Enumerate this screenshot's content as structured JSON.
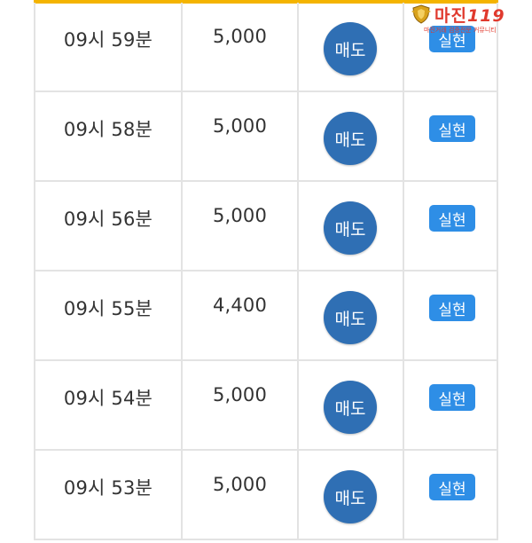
{
  "rows": [
    {
      "time": "09시 59분",
      "amount": "5,000",
      "sell_label": "매도",
      "real_label": "실현"
    },
    {
      "time": "09시 58분",
      "amount": "5,000",
      "sell_label": "매도",
      "real_label": "실현"
    },
    {
      "time": "09시 56분",
      "amount": "5,000",
      "sell_label": "매도",
      "real_label": "실현"
    },
    {
      "time": "09시 55분",
      "amount": "4,400",
      "sell_label": "매도",
      "real_label": "실현"
    },
    {
      "time": "09시 54분",
      "amount": "5,000",
      "sell_label": "매도",
      "real_label": "실현"
    },
    {
      "time": "09시 53분",
      "amount": "5,000",
      "sell_label": "매도",
      "real_label": "실현"
    }
  ],
  "watermark": {
    "brand": "마진",
    "suffix": "119",
    "tagline": "마진거래 검증전문 커뮤니티"
  },
  "colors": {
    "accent_bar": "#f4b400",
    "sell_button": "#2f6fb4",
    "real_badge": "#2e8ee6",
    "watermark": "#e0392d"
  },
  "icons": {
    "watermark_emblem": "shield-badge-icon"
  }
}
